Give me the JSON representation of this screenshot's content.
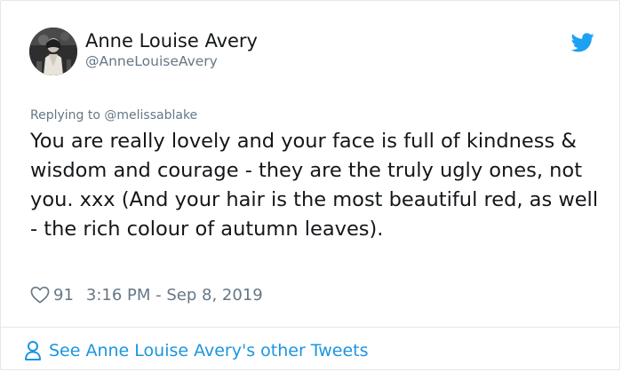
{
  "author": {
    "name": "Anne Louise Avery",
    "handle": "@AnneLouiseAvery"
  },
  "icons": {
    "avatar": "avatar-photo",
    "platform": "twitter-bird-icon",
    "like": "heart-outline-icon",
    "profile": "person-outline-icon"
  },
  "reply": {
    "label": "Replying to",
    "mention": "@melissablake"
  },
  "tweet": {
    "text": "You are really lovely and your face is full of kindness & wisdom and courage - they are the truly ugly ones, not you. xxx (And your hair is the most beautiful red, as well - the rich colour of autumn leaves).",
    "likes": "91",
    "timestamp": "3:16 PM - Sep 8, 2019"
  },
  "footer": {
    "link_label": "See Anne Louise Avery's other Tweets"
  },
  "colors": {
    "link": "#1b95e0",
    "twitter_blue": "#1da1f2",
    "muted": "#657786",
    "text": "#14171a",
    "border": "#e1e8ed"
  }
}
